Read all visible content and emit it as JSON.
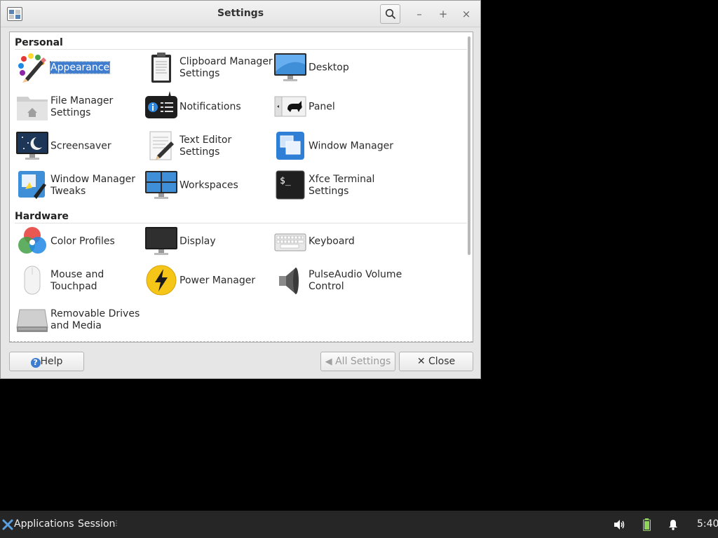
{
  "window": {
    "title": "Settings"
  },
  "sections": [
    {
      "title": "Personal"
    },
    {
      "title": "Hardware"
    }
  ],
  "items": {
    "appearance": "Appearance",
    "clipboard_1": "Clipboard Manager",
    "clipboard_2": "Settings",
    "desktop": "Desktop",
    "file_manager_1": "File Manager",
    "file_manager_2": "Settings",
    "notifications": "Notifications",
    "panel": "Panel",
    "screensaver": "Screensaver",
    "text_editor": "Text Editor Settings",
    "window_manager": "Window Manager",
    "wm_tweaks_1": "Window Manager",
    "wm_tweaks_2": "Tweaks",
    "workspaces": "Workspaces",
    "terminal_1": "Xfce Terminal",
    "terminal_2": "Settings",
    "color_profiles": "Color Profiles",
    "display": "Display",
    "keyboard": "Keyboard",
    "mouse_1": "Mouse and",
    "mouse_2": "Touchpad",
    "power_manager": "Power Manager",
    "pulseaudio_1": "PulseAudio Volume",
    "pulseaudio_2": "Control",
    "removable_1": "Removable Drives",
    "removable_2": "and Media"
  },
  "buttons": {
    "help": "Help",
    "all_settings": "All Settings",
    "close": "Close"
  },
  "taskbar": {
    "applications": "Applications",
    "session": "Session",
    "clock": "5:40"
  }
}
